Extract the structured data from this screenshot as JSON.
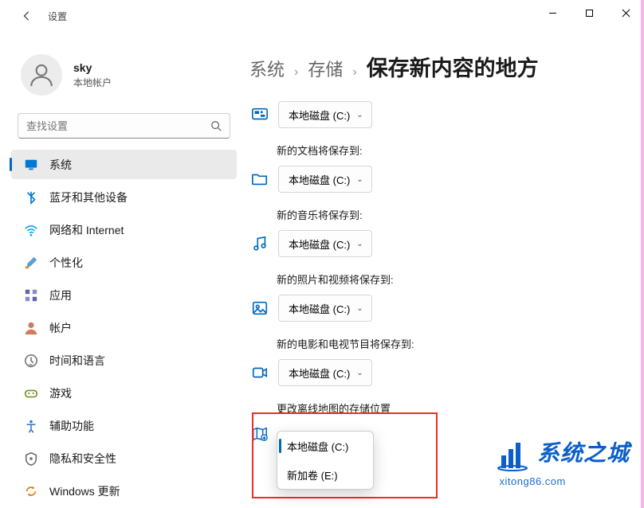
{
  "title": "设置",
  "user": {
    "name": "sky",
    "type": "本地帐户"
  },
  "search": {
    "placeholder": "查找设置"
  },
  "nav": [
    {
      "key": "system",
      "label": "系统",
      "icon": "monitor",
      "color": "#0078d4",
      "active": true
    },
    {
      "key": "bluetooth",
      "label": "蓝牙和其他设备",
      "icon": "bluetooth",
      "color": "#0078d4"
    },
    {
      "key": "network",
      "label": "网络和 Internet",
      "icon": "wifi",
      "color": "#00a4ef"
    },
    {
      "key": "personalize",
      "label": "个性化",
      "icon": "brush",
      "color": "#e58a2e"
    },
    {
      "key": "apps",
      "label": "应用",
      "icon": "grid",
      "color": "#6264a7"
    },
    {
      "key": "accounts",
      "label": "帐户",
      "icon": "person",
      "color": "#d07a5e"
    },
    {
      "key": "time",
      "label": "时间和语言",
      "icon": "clock",
      "color": "#7a7574"
    },
    {
      "key": "gaming",
      "label": "游戏",
      "icon": "gamepad",
      "color": "#6b8e23"
    },
    {
      "key": "accessibility",
      "label": "辅助功能",
      "icon": "access",
      "color": "#3a78d0"
    },
    {
      "key": "privacy",
      "label": "隐私和安全性",
      "icon": "shield",
      "color": "#6d6d6d"
    },
    {
      "key": "update",
      "label": "Windows 更新",
      "icon": "update",
      "color": "#d97a00"
    }
  ],
  "breadcrumb": {
    "level1": "系统",
    "level2": "存储",
    "current": "保存新内容的地方"
  },
  "sections": {
    "apps": {
      "heading": "",
      "value": "本地磁盘 (C:)",
      "icon": "app-blue"
    },
    "docs": {
      "heading": "新的文档将保存到:",
      "value": "本地磁盘 (C:)",
      "icon": "folder"
    },
    "music": {
      "heading": "新的音乐将保存到:",
      "value": "本地磁盘 (C:)",
      "icon": "music"
    },
    "photos": {
      "heading": "新的照片和视频将保存到:",
      "value": "本地磁盘 (C:)",
      "icon": "photo"
    },
    "movies": {
      "heading": "新的电影和电视节目将保存到:",
      "value": "本地磁盘 (C:)",
      "icon": "video"
    },
    "maps": {
      "heading": "更改离线地图的存储位置",
      "value": "本地磁盘 (C:)",
      "icon": "map"
    }
  },
  "maps_dropdown": [
    {
      "label": "本地磁盘 (C:)",
      "selected": true
    },
    {
      "label": "新加卷 (E:)",
      "selected": false
    }
  ],
  "watermark": {
    "top": "系统之城",
    "bottom": "xitong86.com"
  }
}
